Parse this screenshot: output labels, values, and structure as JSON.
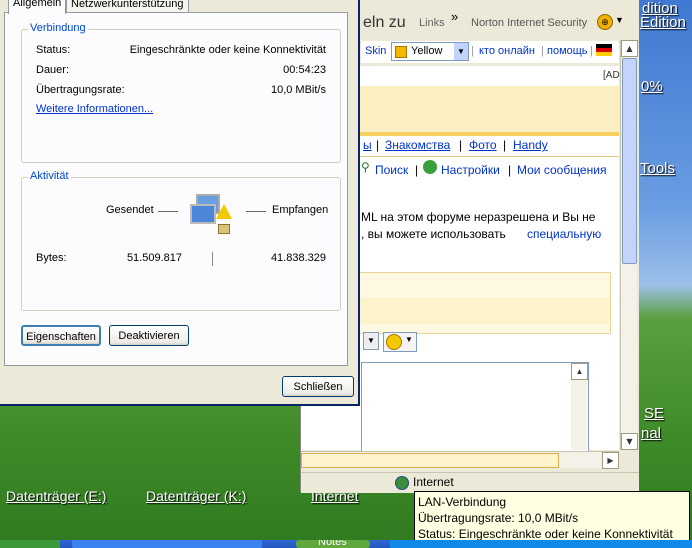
{
  "desktop": {
    "right_fragments": [
      "dition",
      "Edition",
      "0%",
      "Tools",
      "SE",
      "nal"
    ],
    "bottom_labels": [
      "Datenträger (E:)",
      "Datenträger (K:)",
      "Internet"
    ]
  },
  "browser": {
    "toolbar_fragment": "eln zu",
    "links_label": "Links",
    "links_chevron": "»",
    "norton_label": "Norton Internet Security",
    "skin_label": "Skin",
    "skin_value": "Yellow",
    "nav_links": [
      "кто онлайн",
      "помощь"
    ],
    "ad_fragment": "[AD",
    "menu_links": [
      "ы",
      "Знакомства",
      "Фото",
      "Handy"
    ],
    "search_label": "Поиск",
    "settings_label": "Настройки",
    "messages_label": "Мои сообщения",
    "notice_line1": "ML на этом форуме неразрешена и Вы не",
    "notice_line2": ", вы можете использовать",
    "notice_link": "специальную",
    "status_zone": "Internet",
    "colors": {
      "accent_bar": "#f5d060",
      "link": "#0033cc"
    }
  },
  "dialog": {
    "tabs": [
      "Allgemein",
      "Netzwerkunterstützung"
    ],
    "connection": {
      "legend": "Verbindung",
      "status_label": "Status:",
      "status_value": "Eingeschränkte oder keine Konnektivität",
      "duration_label": "Dauer:",
      "duration_value": "00:54:23",
      "speed_label": "Übertragungsrate:",
      "speed_value": "10,0 MBit/s",
      "more_info": "Weitere Informationen..."
    },
    "activity": {
      "legend": "Aktivität",
      "sent_label": "Gesendet",
      "received_label": "Empfangen",
      "bytes_label": "Bytes:",
      "bytes_sent": "51.509.817",
      "bytes_received": "41.838.329"
    },
    "buttons": {
      "properties": "Eigenschaften",
      "disable": "Deaktivieren",
      "close": "Schließen"
    }
  },
  "tooltip": {
    "title": "LAN-Verbindung",
    "speed": "Übertragungsrate: 10,0 MBit/s",
    "status": "Status: Eingeschränkte oder keine Konnektivität"
  },
  "taskbar": {
    "task_label": "Notes"
  }
}
